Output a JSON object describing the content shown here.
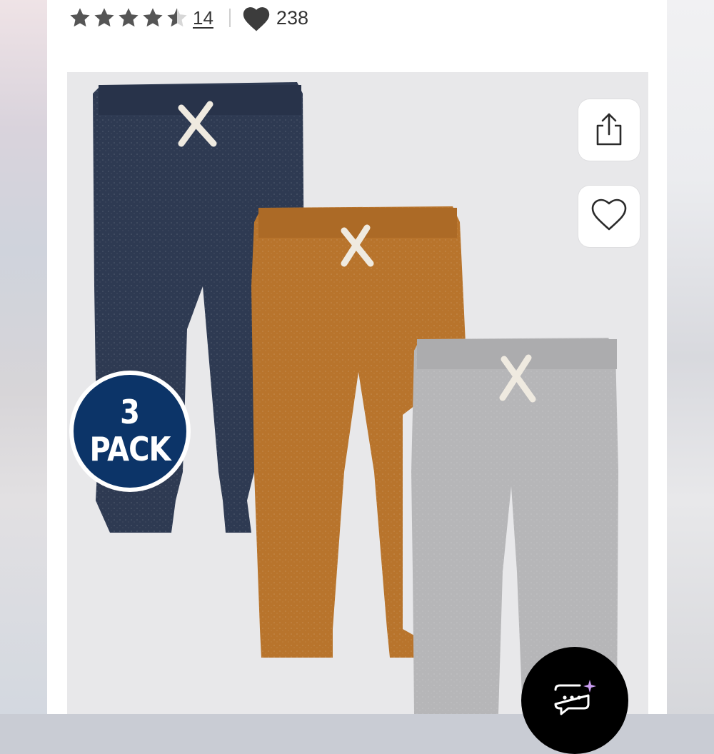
{
  "rating": {
    "stars": 4.5,
    "max_stars": 5,
    "review_count": "14"
  },
  "likes": {
    "count": "238"
  },
  "product_image": {
    "badge_number": "3",
    "badge_word": "PACK",
    "badge_color": "#0c3468",
    "pant_colors": [
      "#2e3a52",
      "#b8742c",
      "#b6b6b8"
    ]
  },
  "icons": {
    "star": "star-icon",
    "like": "heart-icon",
    "share": "share-icon",
    "favorite": "heart-outline-icon",
    "chat": "chat-sparkle-icon"
  }
}
